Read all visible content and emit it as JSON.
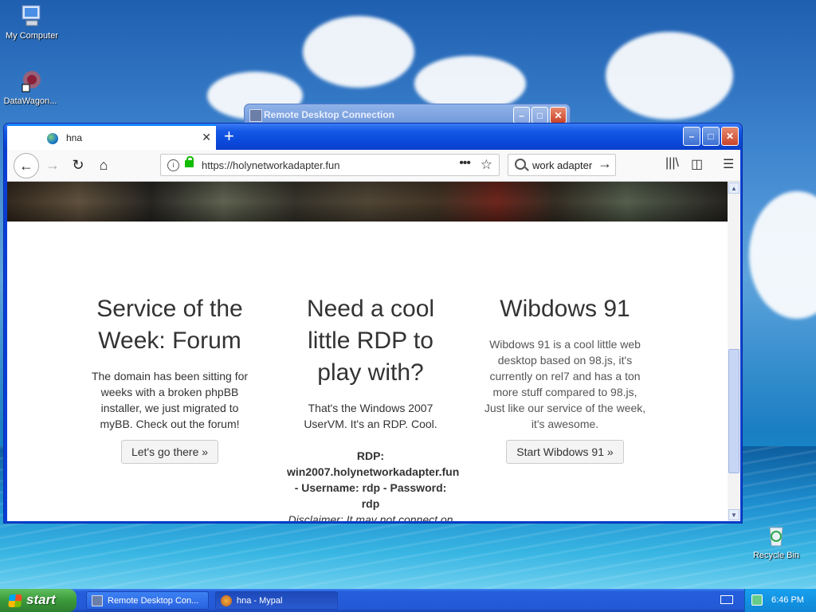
{
  "desktop": {
    "icons": [
      {
        "label": "My Computer"
      },
      {
        "label": "DataWagon..."
      },
      {
        "label": "Recycle Bin"
      }
    ]
  },
  "background_window": {
    "title": "Remote Desktop Connection"
  },
  "browser": {
    "tab_title": "hna",
    "new_tab_symbol": "+",
    "url": "https://holynetworkadapter.fun",
    "search_text": "work adapter",
    "page": {
      "columns": [
        {
          "heading": "Service of the Week: Forum",
          "body": "The domain has been sitting for weeks with a broken phpBB installer, we just migrated to myBB. Check out the forum!",
          "button": "Let's go there »"
        },
        {
          "heading": "Need a cool little RDP to play with?",
          "body": "That's the Windows 2007 UserVM. It's an RDP. Cool.",
          "rdp_bold": "RDP: win2007.holynetworkadapter.fun - Username: rdp - Password: rdp",
          "disclaimer": "Disclaimer: It may not connect on"
        },
        {
          "heading": "Wibdows 91",
          "body": "Wibdows 91 is a cool little web desktop based on 98.js, it's currently on rel7 and has a ton more stuff compared to 98.js, Just like our service of the week, it's awesome.",
          "button": "Start Wibdows 91 »"
        }
      ]
    }
  },
  "taskbar": {
    "start_label": "start",
    "items": [
      {
        "label": "Remote Desktop Con..."
      },
      {
        "label": "hna - Mypal"
      }
    ],
    "clock": "6:46 PM"
  }
}
